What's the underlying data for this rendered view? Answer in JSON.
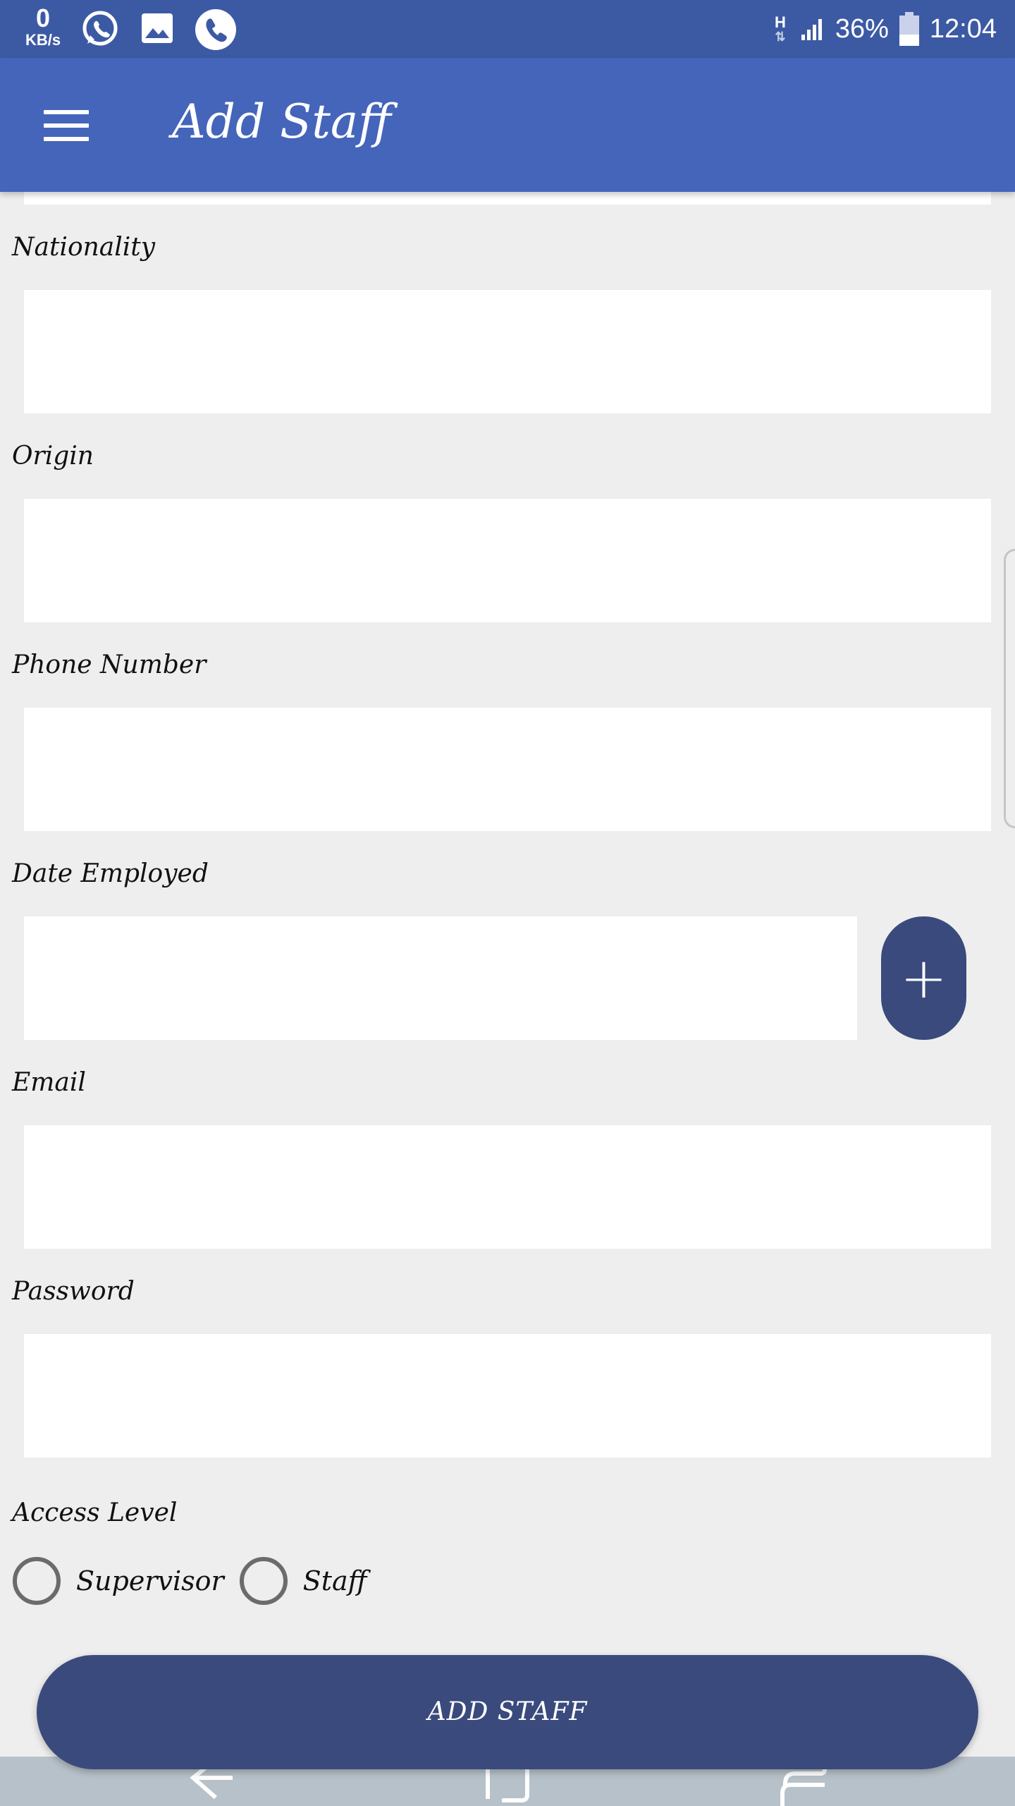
{
  "status_bar": {
    "net_speed": "0",
    "net_unit": "KB/s",
    "network_type": "H",
    "battery": "36%",
    "time": "12:04",
    "icons": [
      "whatsapp-icon",
      "image-icon",
      "phone-icon",
      "signal-icon",
      "battery-icon"
    ]
  },
  "toolbar": {
    "title": "Add Staff",
    "menu_icon": "hamburger-menu-icon"
  },
  "form": {
    "nationality_label": "Nationality",
    "nationality_value": "",
    "origin_label": "Origin",
    "origin_value": "",
    "phone_label": "Phone Number",
    "phone_value": "",
    "date_label": "Date Employed",
    "date_value": "",
    "date_button": "+",
    "email_label": "Email",
    "email_value": "",
    "password_label": "Password",
    "password_value": "",
    "access_label": "Access Level",
    "access_options": [
      "Supervisor",
      "Staff"
    ],
    "submit_label": "ADD STAFF"
  },
  "nav": {
    "items": [
      "back-icon",
      "home-icon",
      "recents-icon"
    ]
  },
  "colors": {
    "status_bar": "#3c5aa4",
    "toolbar": "#4565bb",
    "accent_button": "#3a4a7c",
    "background": "#eeeeee"
  }
}
